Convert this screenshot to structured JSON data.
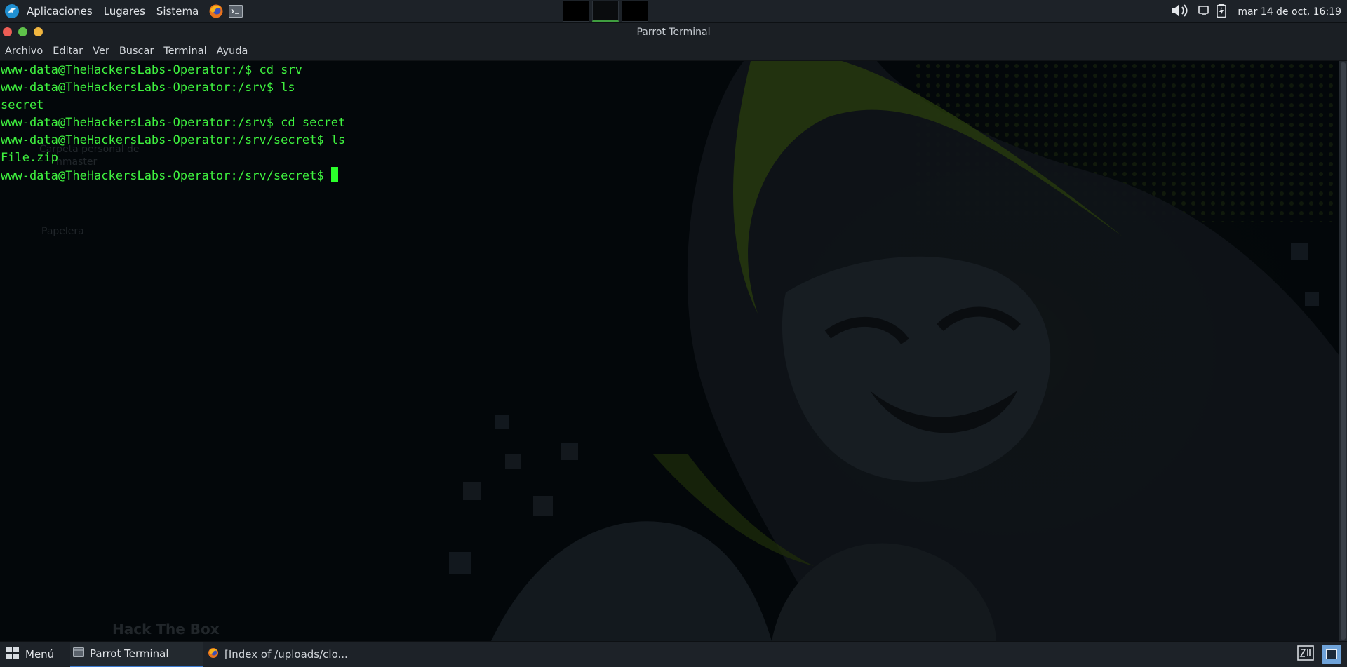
{
  "top_panel": {
    "menus": [
      "Aplicaciones",
      "Lugares",
      "Sistema"
    ],
    "clock": "mar 14 de oct, 16:19",
    "workspaces": 3,
    "active_workspace": 2
  },
  "window": {
    "title": "Parrot Terminal",
    "menu": [
      "Archivo",
      "Editar",
      "Ver",
      "Buscar",
      "Terminal",
      "Ayuda"
    ]
  },
  "terminal": {
    "lines": [
      "www-data@TheHackersLabs-Operator:/$ cd srv",
      "www-data@TheHackersLabs-Operator:/srv$ ls",
      "secret",
      "www-data@TheHackersLabs-Operator:/srv$ cd secret",
      "www-data@TheHackersLabs-Operator:/srv/secret$ ls",
      "File.zip"
    ],
    "prompt": "www-data@TheHackersLabs-Operator:/srv/secret$ "
  },
  "desktop": {
    "ghost_labels": [
      "Carpeta personal de",
      "hmaster",
      "Papelera",
      "Hack The Box"
    ]
  },
  "bottom_panel": {
    "menu_label": "Menú",
    "tasks": [
      {
        "label": "Parrot Terminal",
        "icon": "terminal-icon",
        "active": true
      },
      {
        "label": "[Index of /uploads/clo...",
        "icon": "firefox-icon",
        "active": false
      }
    ]
  },
  "colors": {
    "terminal_text": "#3ff23f",
    "cursor": "#2bff2b",
    "panel_bg": "#1d2228",
    "terminal_bg": "#03070a"
  }
}
